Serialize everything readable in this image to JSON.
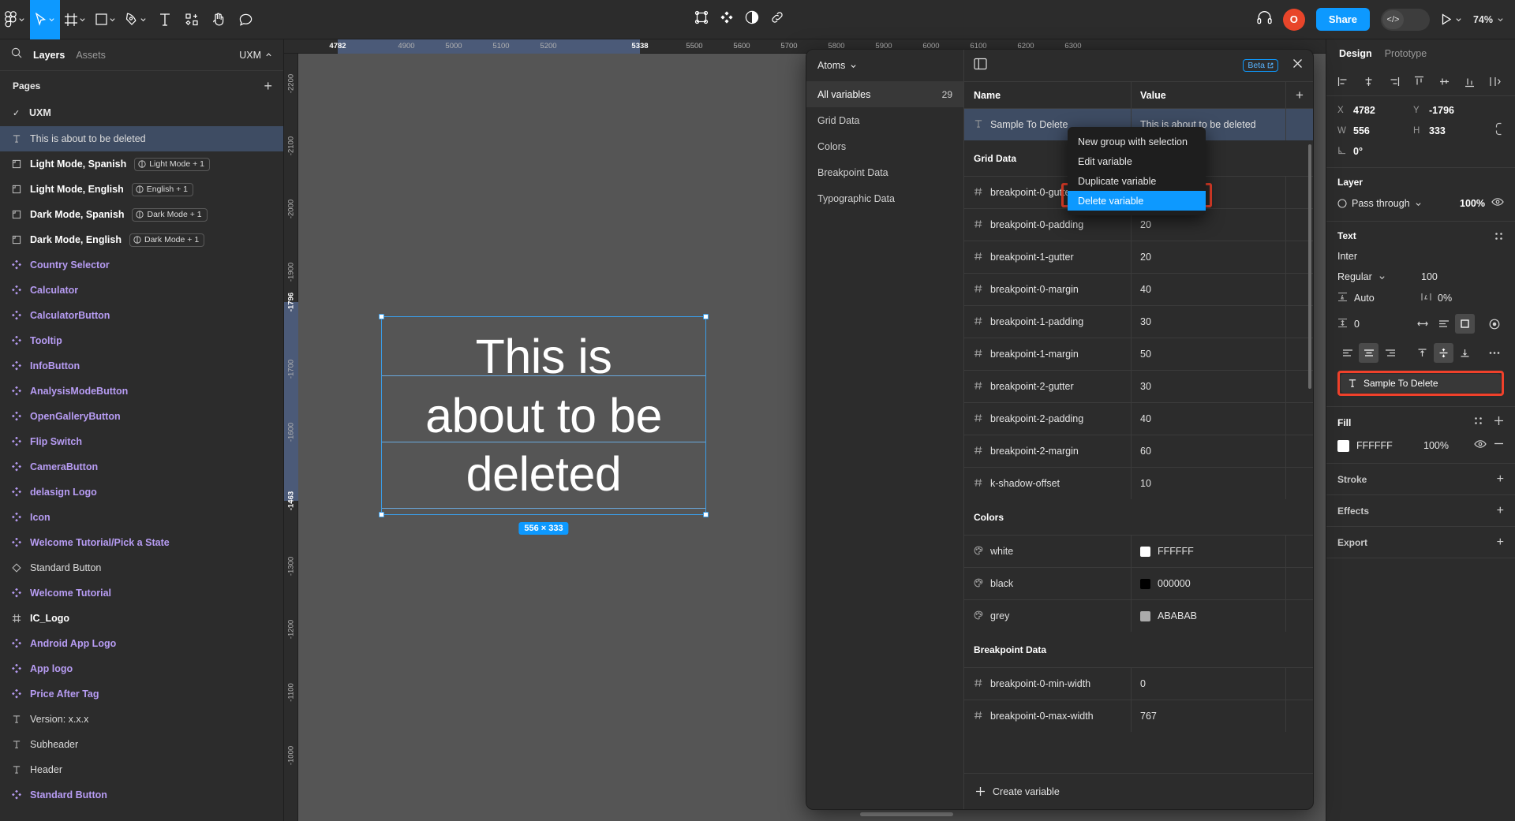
{
  "toolbar": {
    "tools": [
      {
        "name": "figma-logo-icon",
        "caret": true
      },
      {
        "name": "move-tool-icon",
        "caret": true,
        "active": true
      },
      {
        "name": "frame-tool-icon",
        "caret": true
      },
      {
        "name": "shape-tool-icon",
        "caret": true
      },
      {
        "name": "pen-tool-icon",
        "caret": true
      },
      {
        "name": "text-tool-icon",
        "caret": false
      },
      {
        "name": "actions-tool-icon",
        "caret": false
      },
      {
        "name": "hand-tool-icon",
        "caret": false
      },
      {
        "name": "comment-tool-icon",
        "caret": false
      }
    ],
    "center_icons": [
      "components-icon",
      "plugins-icon",
      "contrast-icon",
      "link-icon"
    ],
    "headphones_icon": "headphones-icon",
    "avatar_initial": "O",
    "share_label": "Share",
    "devmode_icon": "code-icon",
    "present_icon": "play-icon",
    "zoom_level": "74%"
  },
  "left_panel": {
    "search_icon": "search-icon",
    "tabs": [
      {
        "label": "Layers",
        "active": true
      },
      {
        "label": "Assets",
        "active": false
      }
    ],
    "file_name": "UXM",
    "pages_title": "Pages",
    "add_page_icon": "plus-icon",
    "pages": [
      {
        "label": "UXM",
        "checked": true
      }
    ],
    "layers": [
      {
        "label": "This is about to be deleted",
        "icon": "text-layer-icon",
        "style": "plain",
        "selected": true
      },
      {
        "label": "Light Mode, Spanish",
        "icon": "frame-layer-icon",
        "style": "bold",
        "chip": "Light Mode + 1"
      },
      {
        "label": "Light Mode, English",
        "icon": "frame-layer-icon",
        "style": "bold",
        "chip": "English + 1"
      },
      {
        "label": "Dark Mode, Spanish",
        "icon": "frame-layer-icon",
        "style": "bold",
        "chip": "Dark Mode + 1"
      },
      {
        "label": "Dark Mode, English",
        "icon": "frame-layer-icon",
        "style": "bold",
        "chip": "Dark Mode + 1"
      },
      {
        "label": "Country Selector",
        "icon": "component-layer-icon",
        "style": "comp"
      },
      {
        "label": "Calculator",
        "icon": "component-layer-icon",
        "style": "comp"
      },
      {
        "label": "CalculatorButton",
        "icon": "component-layer-icon",
        "style": "comp"
      },
      {
        "label": "Tooltip",
        "icon": "component-layer-icon",
        "style": "comp"
      },
      {
        "label": "InfoButton",
        "icon": "component-layer-icon",
        "style": "comp"
      },
      {
        "label": "AnalysisModeButton",
        "icon": "component-layer-icon",
        "style": "comp"
      },
      {
        "label": "OpenGalleryButton",
        "icon": "component-layer-icon",
        "style": "comp"
      },
      {
        "label": "Flip Switch",
        "icon": "component-layer-icon",
        "style": "comp"
      },
      {
        "label": "CameraButton",
        "icon": "component-layer-icon",
        "style": "comp"
      },
      {
        "label": "delasign Logo",
        "icon": "component-layer-icon",
        "style": "comp"
      },
      {
        "label": "Icon",
        "icon": "component-layer-icon",
        "style": "comp"
      },
      {
        "label": "Welcome Tutorial/Pick a State",
        "icon": "component-layer-icon",
        "style": "comp"
      },
      {
        "label": "Standard Button",
        "icon": "variant-layer-icon",
        "style": "plain"
      },
      {
        "label": "Welcome Tutorial",
        "icon": "component-layer-icon",
        "style": "comp"
      },
      {
        "label": "IC_Logo",
        "icon": "grid-layer-icon",
        "style": "bold"
      },
      {
        "label": "Android App Logo",
        "icon": "component-layer-icon",
        "style": "comp"
      },
      {
        "label": "App logo",
        "icon": "component-layer-icon",
        "style": "comp"
      },
      {
        "label": "Price After Tag",
        "icon": "component-layer-icon",
        "style": "comp"
      },
      {
        "label": "Version: x.x.x",
        "icon": "text-layer-icon",
        "style": "plain"
      },
      {
        "label": "Subheader",
        "icon": "text-layer-icon",
        "style": "plain"
      },
      {
        "label": "Header",
        "icon": "text-layer-icon",
        "style": "plain"
      },
      {
        "label": "Standard Button",
        "icon": "component-layer-icon",
        "style": "comp"
      }
    ]
  },
  "canvas": {
    "ruler_h_ticks": [
      "4782",
      "4900",
      "5000",
      "5100",
      "5200",
      "5338",
      "5500",
      "5600",
      "5700",
      "5800",
      "5900",
      "6000",
      "6100",
      "6200",
      "6300"
    ],
    "ruler_v_ticks": [
      "-2200",
      "-2100",
      "-2000",
      "-1900",
      "-1796",
      "-1700",
      "-1600",
      "-1463",
      "-1300",
      "-1200",
      "-1100",
      "-1000"
    ],
    "selection_lines": [
      "This is",
      "about to be",
      "deleted"
    ],
    "dimension_badge": "556 × 333",
    "help_label": "?"
  },
  "variables_modal": {
    "collection_name": "Atoms",
    "sidebar_panel_icon": "panel-toggle-icon",
    "beta_label": "Beta",
    "beta_icon": "external-link-icon",
    "close_icon": "close-icon",
    "categories": [
      {
        "label": "All variables",
        "count": "29",
        "active": true
      },
      {
        "label": "Grid Data",
        "count": "",
        "active": false
      },
      {
        "label": "Colors",
        "count": "",
        "active": false
      },
      {
        "label": "Breakpoint Data",
        "count": "",
        "active": false
      },
      {
        "label": "Typographic Data",
        "count": "",
        "active": false
      }
    ],
    "columns": {
      "name": "Name",
      "value": "Value",
      "add_icon": "plus-icon"
    },
    "selected_row": {
      "name": "Sample To Delete",
      "value": "This is about to be deleted",
      "icon": "string-var-icon"
    },
    "groups": [
      {
        "title": "Grid Data",
        "rows": [
          {
            "name": "breakpoint-0-gutter",
            "value": "",
            "icon": "number-var-icon"
          },
          {
            "name": "breakpoint-0-padding",
            "value": "20",
            "icon": "number-var-icon"
          },
          {
            "name": "breakpoint-1-gutter",
            "value": "20",
            "icon": "number-var-icon"
          },
          {
            "name": "breakpoint-0-margin",
            "value": "40",
            "icon": "number-var-icon"
          },
          {
            "name": "breakpoint-1-padding",
            "value": "30",
            "icon": "number-var-icon"
          },
          {
            "name": "breakpoint-1-margin",
            "value": "50",
            "icon": "number-var-icon"
          },
          {
            "name": "breakpoint-2-gutter",
            "value": "30",
            "icon": "number-var-icon"
          },
          {
            "name": "breakpoint-2-padding",
            "value": "40",
            "icon": "number-var-icon"
          },
          {
            "name": "breakpoint-2-margin",
            "value": "60",
            "icon": "number-var-icon"
          },
          {
            "name": "k-shadow-offset",
            "value": "10",
            "icon": "number-var-icon"
          }
        ]
      },
      {
        "title": "Colors",
        "rows": [
          {
            "name": "white",
            "value": "FFFFFF",
            "icon": "color-var-icon",
            "swatch": "#FFFFFF"
          },
          {
            "name": "black",
            "value": "000000",
            "icon": "color-var-icon",
            "swatch": "#000000"
          },
          {
            "name": "grey",
            "value": "ABABAB",
            "icon": "color-var-icon",
            "swatch": "#ABABAB"
          }
        ]
      },
      {
        "title": "Breakpoint Data",
        "rows": [
          {
            "name": "breakpoint-0-min-width",
            "value": "0",
            "icon": "number-var-icon"
          },
          {
            "name": "breakpoint-0-max-width",
            "value": "767",
            "icon": "number-var-icon"
          }
        ]
      }
    ],
    "create_label": "Create variable",
    "create_icon": "plus-icon"
  },
  "context_menu": {
    "items": [
      {
        "label": "New group with selection",
        "selected": false
      },
      {
        "label": "Edit variable",
        "selected": false
      },
      {
        "label": "Duplicate variable",
        "selected": false
      },
      {
        "label": "Delete variable",
        "selected": true
      }
    ],
    "highlight_color": "#f0412b"
  },
  "right_panel": {
    "tabs": [
      {
        "label": "Design",
        "active": true
      },
      {
        "label": "Prototype",
        "active": false
      }
    ],
    "align_icons": [
      "align-left-icon",
      "align-horizontal-center-icon",
      "align-right-icon",
      "align-top-icon",
      "align-vertical-center-icon",
      "align-bottom-icon",
      "distribute-icon"
    ],
    "position": {
      "x_label": "X",
      "x_value": "4782",
      "y_label": "Y",
      "y_value": "-1796",
      "w_label": "W",
      "w_value": "556",
      "h_label": "H",
      "h_value": "333",
      "rotation_label": "rotation-icon",
      "rotation_value": "0°",
      "link_icon": "constrain-proportions-icon"
    },
    "layer": {
      "title": "Layer",
      "blend_mode": "Pass through",
      "opacity": "100%",
      "visibility_icon": "eye-icon",
      "blend_icon": "blend-icon"
    },
    "text": {
      "title": "Text",
      "settings_icon": "text-settings-icon",
      "font_family": "Inter",
      "font_weight": "Regular",
      "font_size": "100",
      "line_height_label": "Auto",
      "line_height_icon": "line-height-icon",
      "letter_spacing": "0%",
      "letter_spacing_icon": "letter-spacing-icon",
      "paragraph_spacing": "0",
      "paragraph_icon": "paragraph-spacing-icon",
      "resize_icons": [
        "horizontal-resize-icon",
        "auto-height-icon",
        "fixed-size-icon"
      ],
      "type_detail_icon": "type-detail-icon",
      "align_icons": [
        "text-align-left-icon",
        "text-align-center-icon",
        "text-align-right-icon"
      ],
      "valign_icons": [
        "text-valign-top-icon",
        "text-valign-middle-icon",
        "text-valign-bottom-icon"
      ],
      "more_icon": "more-options-icon",
      "variable_pill": "Sample To Delete",
      "variable_pill_icon": "string-var-icon"
    },
    "fill": {
      "title": "Fill",
      "style_icon": "styles-icon",
      "add_icon": "plus-icon",
      "color": "FFFFFF",
      "swatch": "#FFFFFF",
      "opacity": "100%",
      "visibility_icon": "eye-icon",
      "remove_icon": "minus-icon"
    },
    "sections": [
      {
        "title": "Stroke",
        "add_icon": "plus-icon"
      },
      {
        "title": "Effects",
        "add_icon": "plus-icon"
      },
      {
        "title": "Export",
        "add_icon": "plus-icon"
      }
    ]
  }
}
